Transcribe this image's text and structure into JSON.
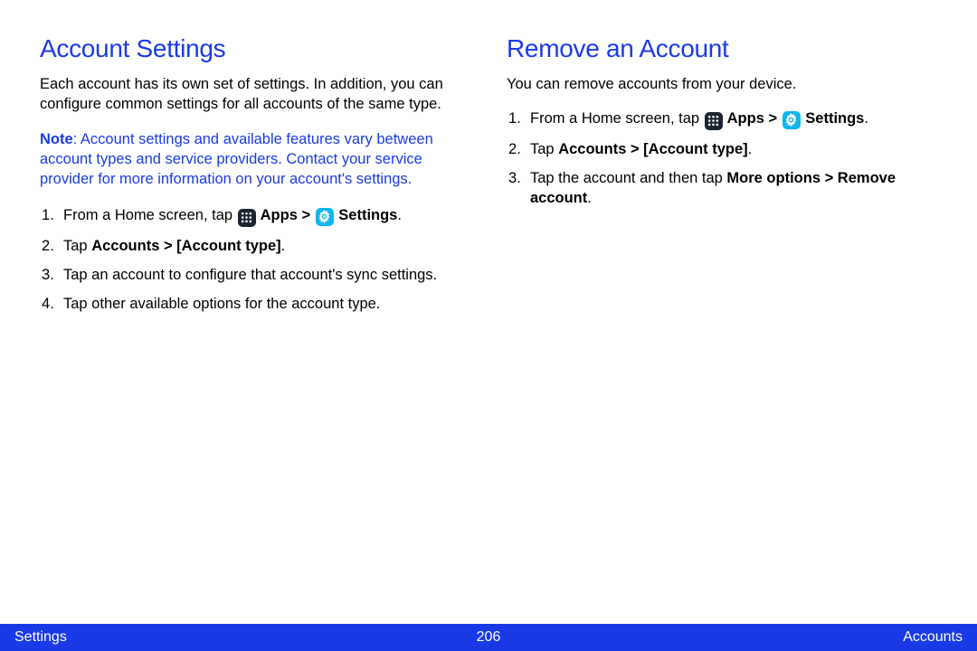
{
  "left": {
    "heading": "Account Settings",
    "intro": "Each account has its own set of settings. In addition, you can configure common settings for all accounts of the same type.",
    "note_label": "Note",
    "note_body": ": Account settings and available features vary between account types and service providers. Contact your service provider for more information on your account's settings.",
    "steps": {
      "s1_pre": "From a Home screen, tap ",
      "s1_apps": " Apps > ",
      "s1_settings": " Settings",
      "s1_end": ".",
      "s2_pre": "Tap ",
      "s2_bold": "Accounts > [Account type]",
      "s2_end": ".",
      "s3": "Tap an account to configure that account's sync settings.",
      "s4": "Tap other available options for the account type."
    }
  },
  "right": {
    "heading": "Remove an Account",
    "intro": "You can remove accounts from your device.",
    "steps": {
      "s1_pre": "From a Home screen, tap ",
      "s1_apps": " Apps > ",
      "s1_settings": " Settings",
      "s1_end": ".",
      "s2_pre": "Tap ",
      "s2_bold": "Accounts > [Account type]",
      "s2_end": ".",
      "s3_pre": "Tap the account and then tap    ",
      "s3_bold": "More options > Remove account",
      "s3_end": "."
    }
  },
  "footer": {
    "left": "Settings",
    "center": "206",
    "right": "Accounts"
  }
}
